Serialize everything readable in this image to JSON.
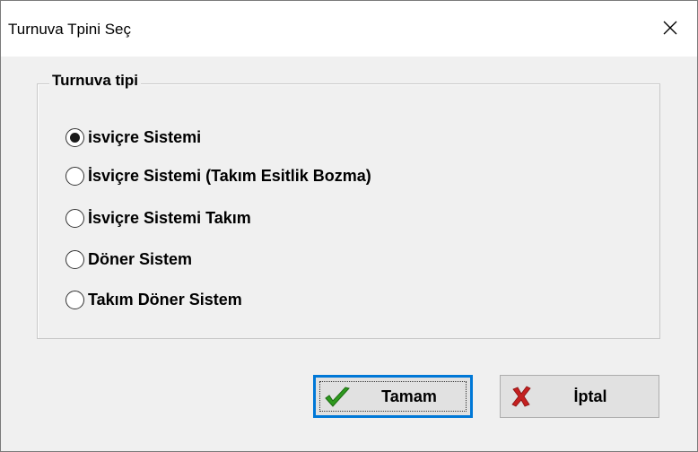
{
  "window": {
    "title": "Turnuva Tpini Seç"
  },
  "group": {
    "legend": "Turnuva tipi"
  },
  "options": [
    {
      "label": "isviçre Sistemi",
      "selected": true
    },
    {
      "label": "İsviçre Sistemi (Takım Esitlik Bozma)",
      "selected": false
    },
    {
      "label": "İsviçre Sistemi Takım",
      "selected": false
    },
    {
      "label": "Döner Sistem",
      "selected": false
    },
    {
      "label": "Takım Döner Sistem",
      "selected": false
    }
  ],
  "buttons": {
    "ok_label": "Tamam",
    "cancel_label": "İptal"
  },
  "icons": {
    "close": "close-icon",
    "ok": "checkmark-icon",
    "cancel": "x-mark-icon"
  },
  "colors": {
    "focus_border": "#0078d7",
    "check_green": "#2e9a1e",
    "cancel_red": "#c42020"
  }
}
